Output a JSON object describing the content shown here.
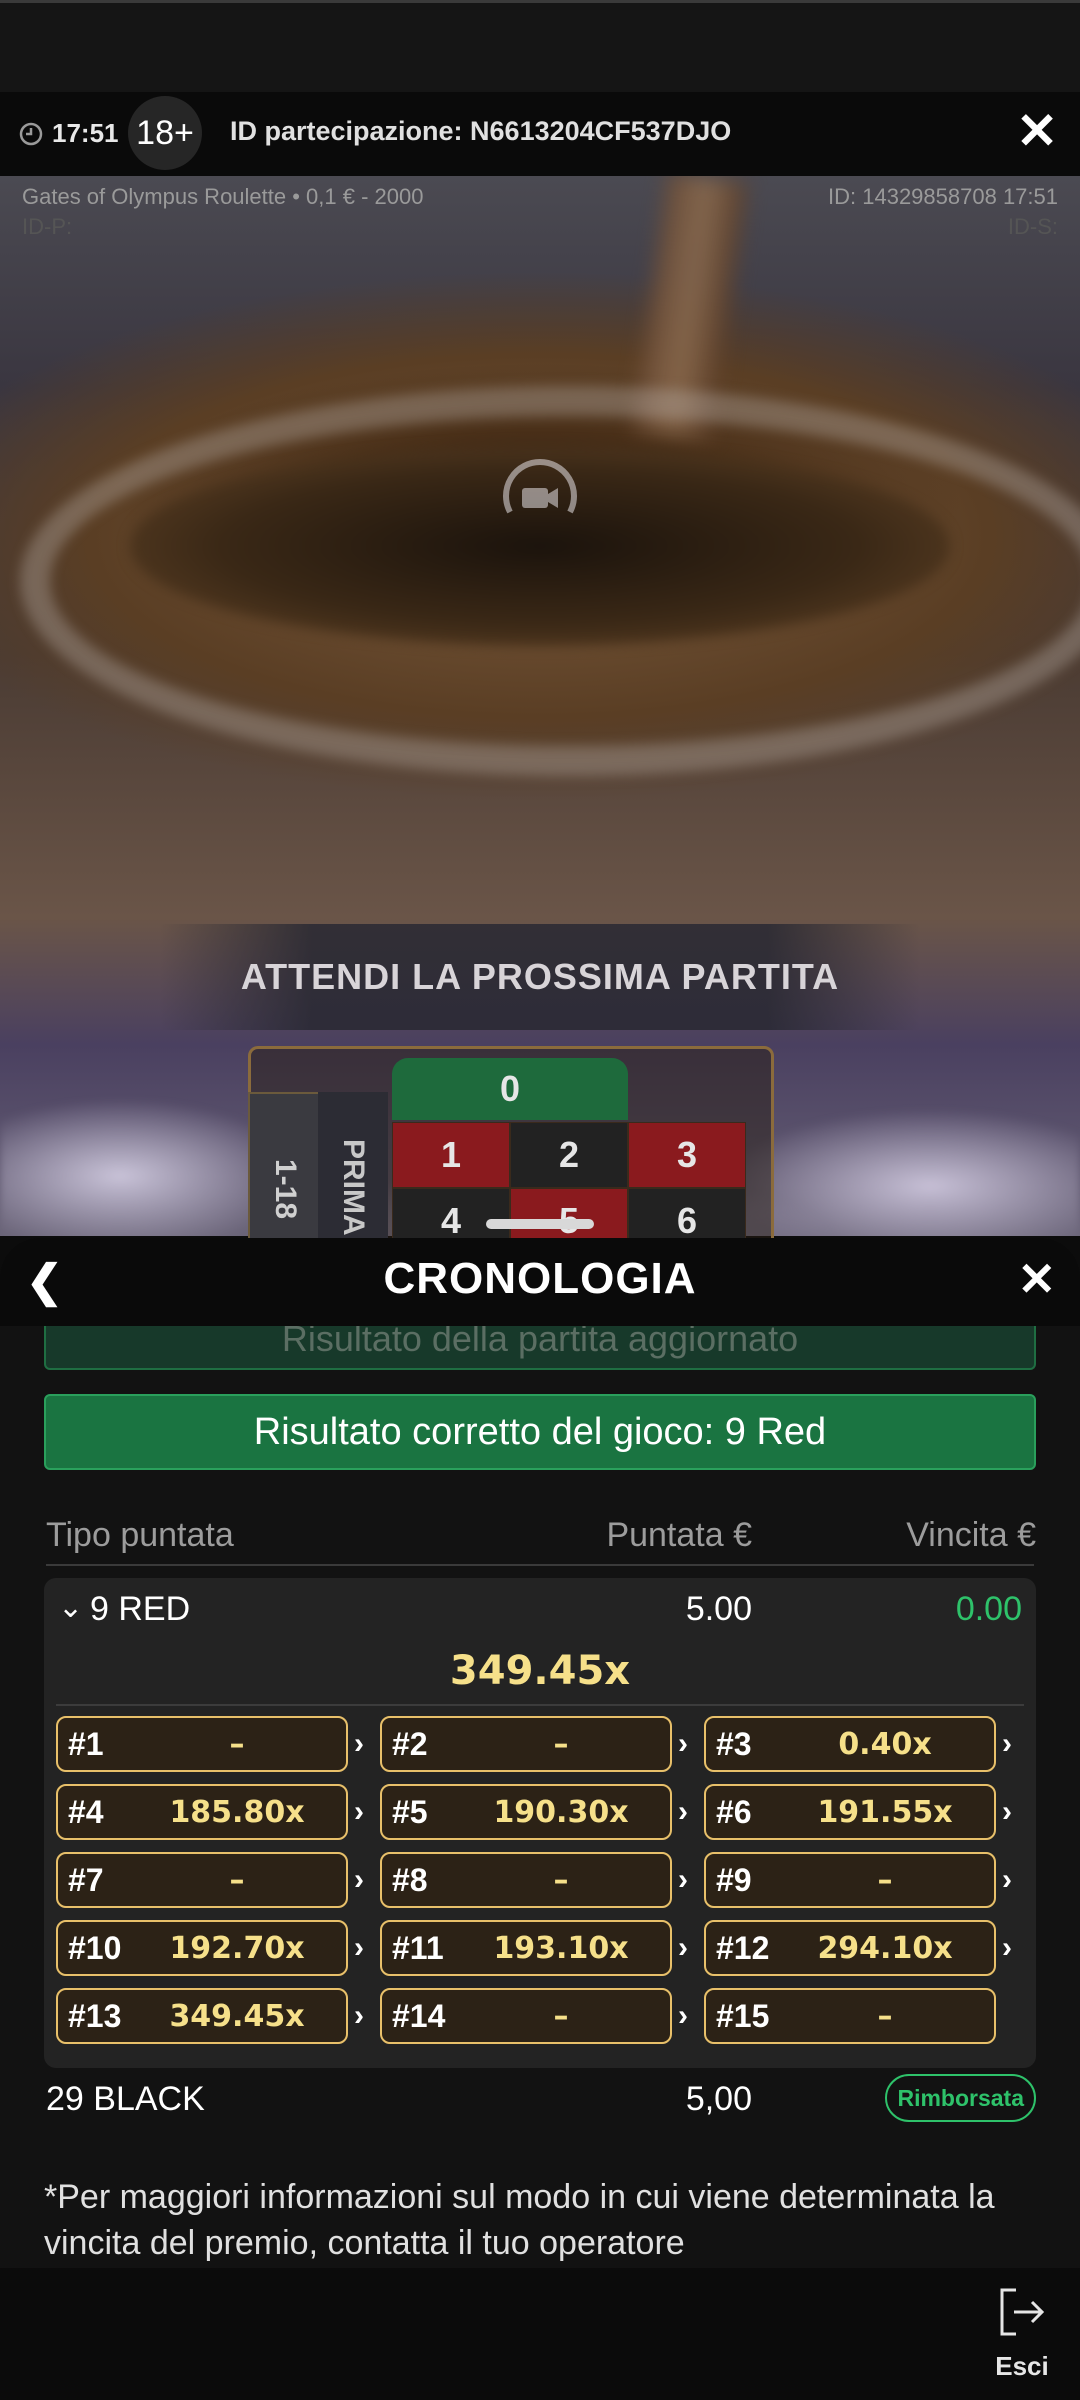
{
  "status": {
    "time": "17:51"
  },
  "header": {
    "age_badge": "18+",
    "participation_id": "ID partecipazione: N6613204CF537DJO"
  },
  "video": {
    "game_info": "Gates of Olympus Roulette • 0,1 € - 2000",
    "id_p": "ID-P:",
    "round_id": "ID: 14329858708 17:51",
    "id_s": "ID-S:",
    "banner": "ATTENDI LA PROSSIMA PARTITA"
  },
  "table": {
    "zero": "0",
    "cells": [
      {
        "n": "1",
        "color": "red"
      },
      {
        "n": "2",
        "color": "black"
      },
      {
        "n": "3",
        "color": "red"
      },
      {
        "n": "4",
        "color": "black"
      },
      {
        "n": "5",
        "color": "red"
      },
      {
        "n": "6",
        "color": "black"
      }
    ],
    "side_a": "1-18",
    "side_b": "PRIMA"
  },
  "sheet": {
    "title": "CRONOLOGIA",
    "prev_note": "Risultato della partita aggiornato",
    "result_banner": "Risultato corretto del gioco: 9 Red",
    "columns": {
      "type": "Tipo puntata",
      "stake": "Puntata €",
      "win": "Vincita €"
    }
  },
  "bet1": {
    "name": "9 RED",
    "stake": "5.00",
    "win": "0.00",
    "multiplier": "349.45x",
    "slots": [
      {
        "n": "#1",
        "v": "–"
      },
      {
        "n": "#2",
        "v": "–"
      },
      {
        "n": "#3",
        "v": "0.40x"
      },
      {
        "n": "#4",
        "v": "185.80x"
      },
      {
        "n": "#5",
        "v": "190.30x"
      },
      {
        "n": "#6",
        "v": "191.55x"
      },
      {
        "n": "#7",
        "v": "–"
      },
      {
        "n": "#8",
        "v": "–"
      },
      {
        "n": "#9",
        "v": "–"
      },
      {
        "n": "#10",
        "v": "192.70x"
      },
      {
        "n": "#11",
        "v": "193.10x"
      },
      {
        "n": "#12",
        "v": "294.10x"
      },
      {
        "n": "#13",
        "v": "349.45x"
      },
      {
        "n": "#14",
        "v": "–"
      },
      {
        "n": "#15",
        "v": "–"
      }
    ]
  },
  "bet2": {
    "name": "29 BLACK",
    "stake": "5,00",
    "badge": "Rimborsata"
  },
  "footnote": "*Per maggiori informazioni sul modo in cui viene determinata la vincita del premio, contatta il tuo operatore",
  "footer": {
    "exit_label": "Esci"
  },
  "colors": {
    "accent_green": "#1a7441",
    "gold": "#e8c06a",
    "red": "#8a1a1e",
    "win_green": "#2ec26a"
  }
}
